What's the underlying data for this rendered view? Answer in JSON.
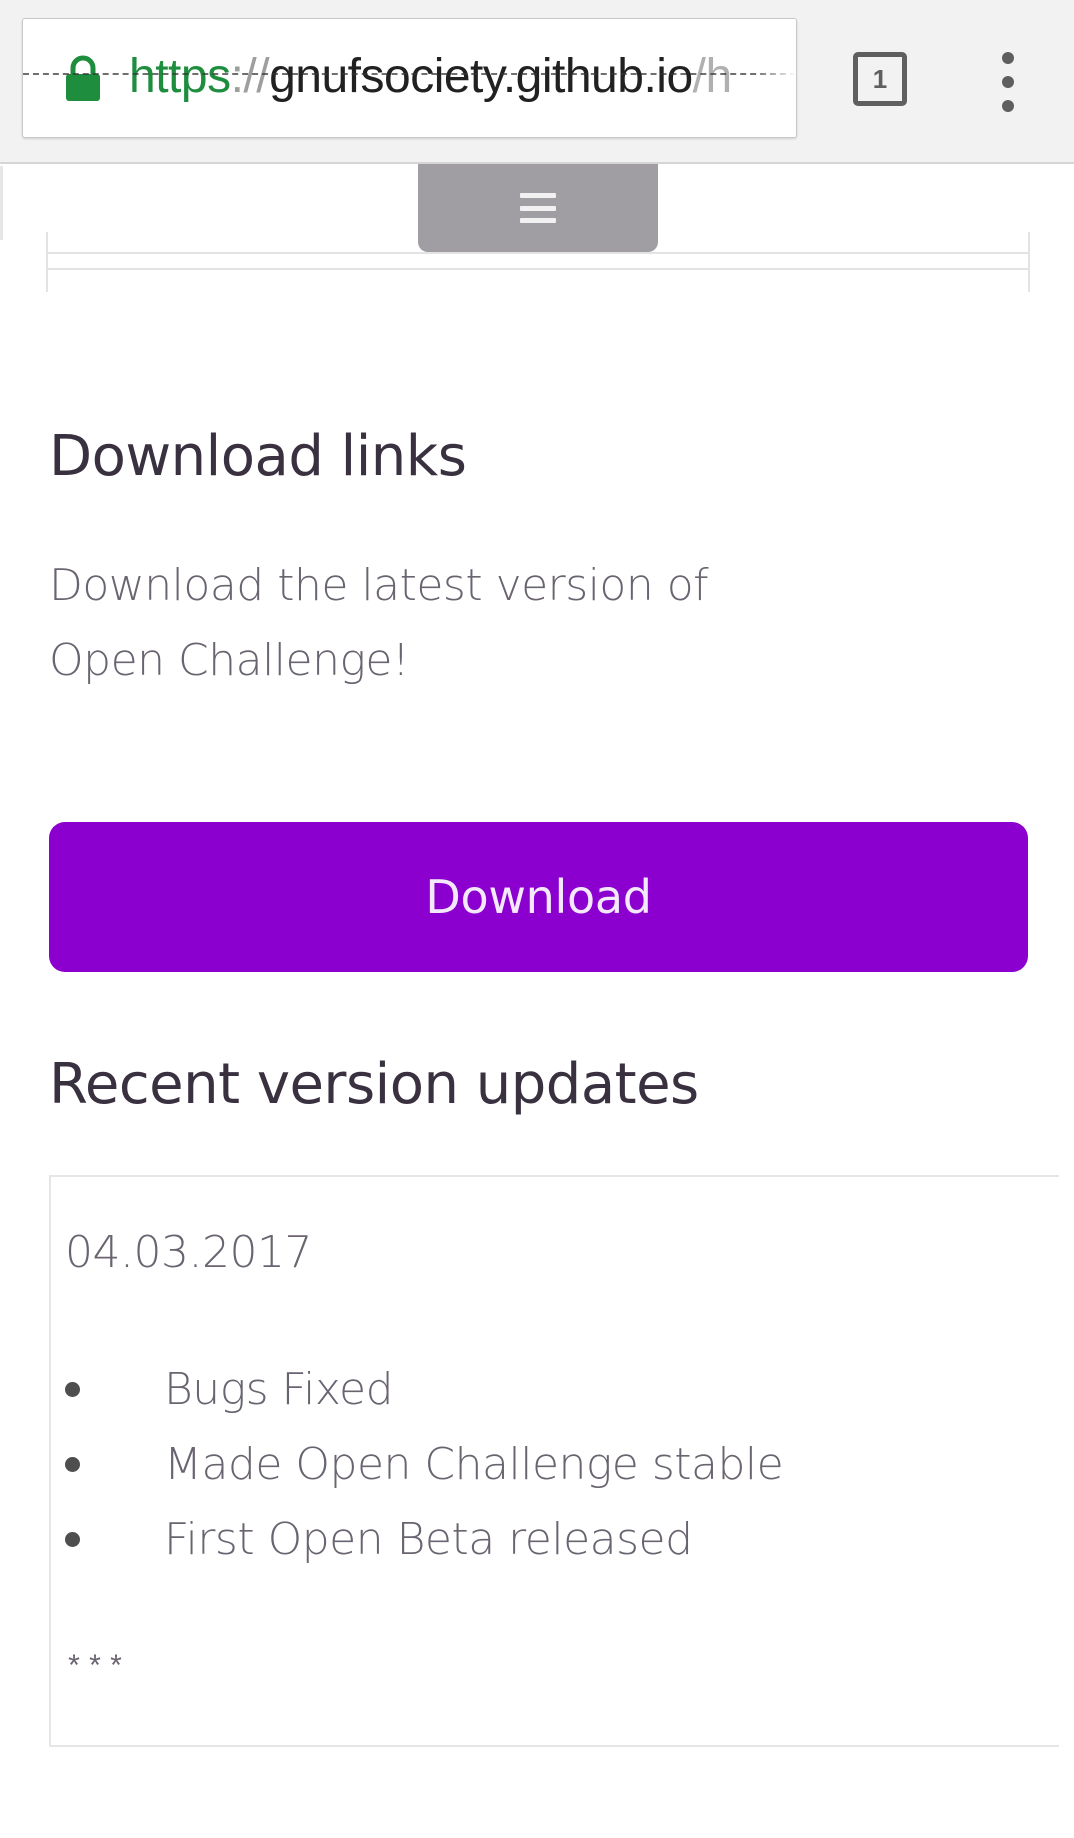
{
  "browser": {
    "url_scheme": "https",
    "url_separator": "://",
    "url_host": "gnufsociety.github.io",
    "url_rest": "/h",
    "tab_count": "1",
    "icons": {
      "lock": "lock-icon",
      "tabs": "tab-switcher-icon",
      "menu": "more-vert-icon"
    },
    "colors": {
      "secure_scheme": "#1e8e3e"
    }
  },
  "page": {
    "nav_toggle_icon": "hamburger-icon",
    "download_section": {
      "title": "Download links",
      "description": "Download the latest version of Open Challenge!",
      "button_label": "Download",
      "button_color": "#8b00cf"
    },
    "updates_section": {
      "title": "Recent version updates",
      "entries": [
        {
          "date": "04.03.2017",
          "items": [
            "Bugs Fixed",
            "Made Open Challenge stable",
            "First Open Beta released"
          ]
        }
      ],
      "separator": "***"
    }
  }
}
